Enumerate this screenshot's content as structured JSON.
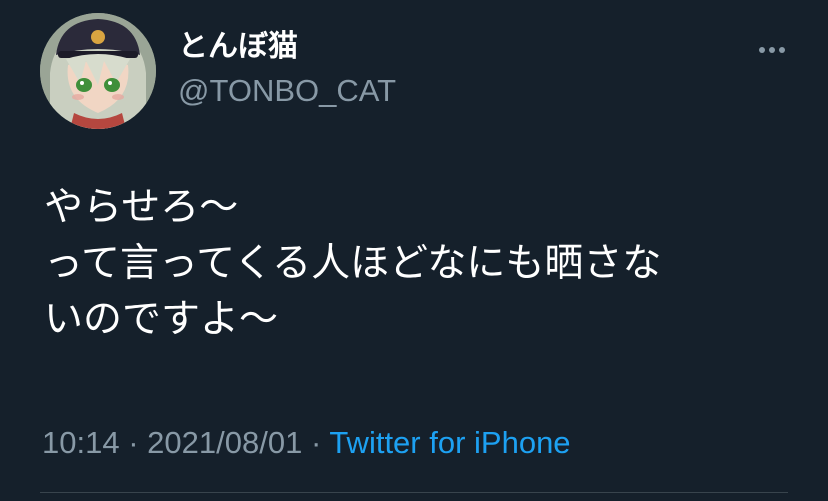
{
  "tweet": {
    "author": {
      "display_name": "とんぼ猫",
      "handle": "@TONBO_CAT",
      "avatar_icon": "anime-avatar"
    },
    "more_icon": "more-horizontal-icon",
    "text_lines": [
      "やらせろ〜",
      "って言ってくる人ほどなにも晒さな",
      "いのですよ〜"
    ],
    "time": "10:14",
    "separator": "·",
    "date": "2021/08/01",
    "source": "Twitter for iPhone"
  },
  "colors": {
    "background": "#15202b",
    "primary_text": "#ffffff",
    "secondary_text": "#8899a6",
    "link": "#1da1f2",
    "divider": "#38444d"
  }
}
